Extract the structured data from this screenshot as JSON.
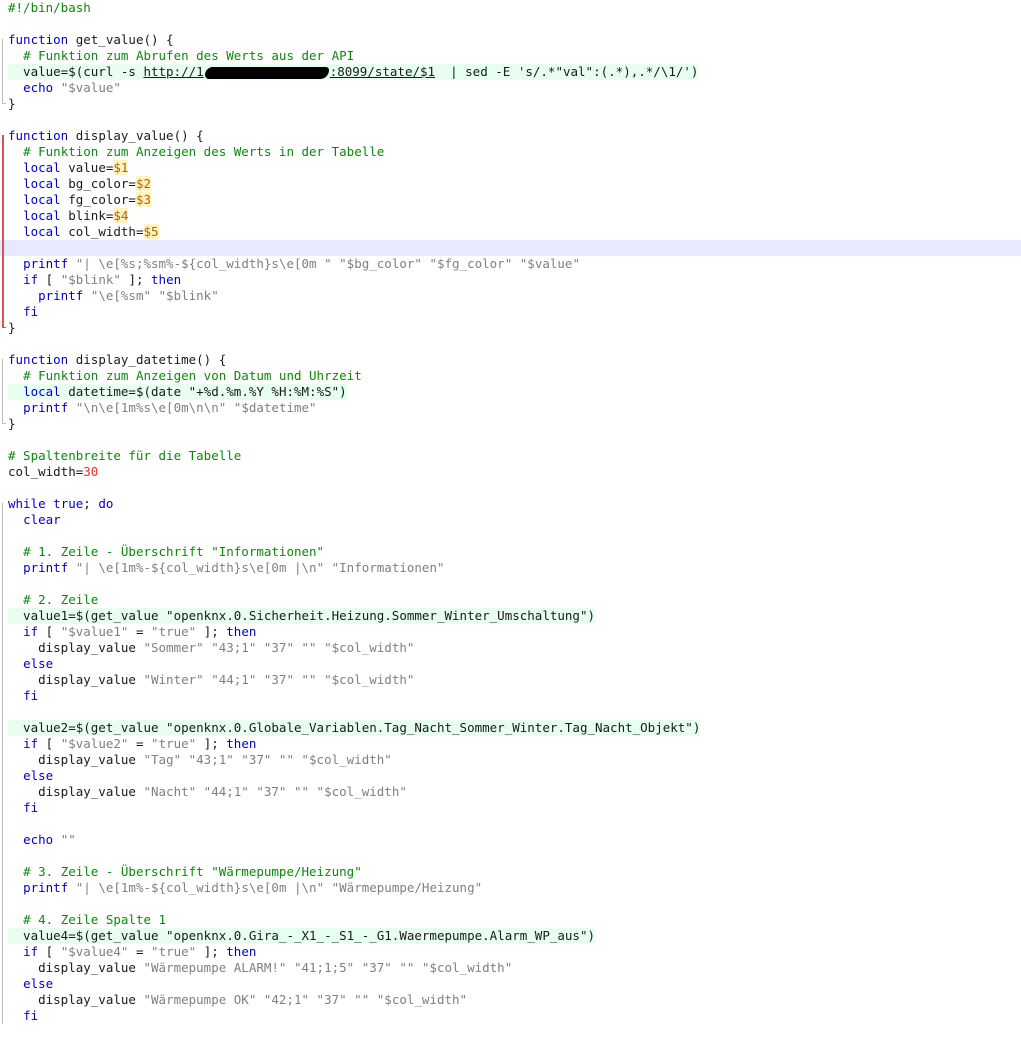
{
  "editor": {
    "language": "bash",
    "current_line": 16,
    "colors": {
      "comment": "#0a8a0a",
      "keyword": "#0000cc",
      "string": "#808080",
      "variable": "#c06000",
      "number": "#e03030",
      "current_line_bg": "#e8e8ff",
      "change_bar": "#e05050"
    },
    "lines": [
      {
        "fold": "none",
        "tokens": [
          [
            "comment",
            "#!/bin/bash"
          ]
        ]
      },
      {
        "fold": "none",
        "tokens": []
      },
      {
        "fold": "start",
        "tokens": [
          [
            "keyword",
            "function"
          ],
          [
            "plain",
            " get_value() {"
          ]
        ]
      },
      {
        "fold": "mid",
        "tokens": [
          [
            "plain",
            "  "
          ],
          [
            "comment",
            "# Funktion zum Abrufen des Werts aus der API"
          ]
        ]
      },
      {
        "fold": "mid",
        "hl": true,
        "tokens": [
          [
            "plain",
            "  value=$(curl -s "
          ],
          [
            "url",
            "http://1"
          ],
          [
            "redact",
            ""
          ],
          [
            "url",
            ":8099/state/$1"
          ],
          [
            "plain",
            "  | sed -E 's/.*\"val\":(.*),.*/\\1/')"
          ]
        ]
      },
      {
        "fold": "mid",
        "tokens": [
          [
            "plain",
            "  "
          ],
          [
            "keyword",
            "echo"
          ],
          [
            "plain",
            " "
          ],
          [
            "string",
            "\"$value\""
          ]
        ]
      },
      {
        "fold": "end",
        "tokens": [
          [
            "plain",
            "}"
          ]
        ]
      },
      {
        "fold": "none",
        "tokens": []
      },
      {
        "fold": "start-changed",
        "tokens": [
          [
            "keyword",
            "function"
          ],
          [
            "plain",
            " display_value() {"
          ]
        ]
      },
      {
        "fold": "mid-changed",
        "tokens": [
          [
            "plain",
            "  "
          ],
          [
            "comment",
            "# Funktion zum Anzeigen des Werts in der Tabelle"
          ]
        ]
      },
      {
        "fold": "mid-changed",
        "tokens": [
          [
            "plain",
            "  "
          ],
          [
            "keyword",
            "local"
          ],
          [
            "plain",
            " value="
          ],
          [
            "var",
            "$1"
          ]
        ]
      },
      {
        "fold": "mid-changed",
        "tokens": [
          [
            "plain",
            "  "
          ],
          [
            "keyword",
            "local"
          ],
          [
            "plain",
            " bg_color="
          ],
          [
            "var",
            "$2"
          ]
        ]
      },
      {
        "fold": "mid-changed",
        "tokens": [
          [
            "plain",
            "  "
          ],
          [
            "keyword",
            "local"
          ],
          [
            "plain",
            " fg_color="
          ],
          [
            "var",
            "$3"
          ]
        ]
      },
      {
        "fold": "mid-changed",
        "tokens": [
          [
            "plain",
            "  "
          ],
          [
            "keyword",
            "local"
          ],
          [
            "plain",
            " blink="
          ],
          [
            "var",
            "$4"
          ]
        ]
      },
      {
        "fold": "mid-changed",
        "tokens": [
          [
            "plain",
            "  "
          ],
          [
            "keyword",
            "local"
          ],
          [
            "plain",
            " col_width="
          ],
          [
            "var",
            "$5"
          ]
        ]
      },
      {
        "fold": "mid-changed",
        "current": true,
        "tokens": []
      },
      {
        "fold": "mid-changed",
        "tokens": [
          [
            "plain",
            "  "
          ],
          [
            "keyword",
            "printf"
          ],
          [
            "plain",
            " "
          ],
          [
            "string",
            "\"| \\e[%s;%sm%-${col_width}s\\e[0m \" \"$bg_color\" \"$fg_color\" \"$value\""
          ]
        ]
      },
      {
        "fold": "mid-changed",
        "tokens": [
          [
            "plain",
            "  "
          ],
          [
            "keyword",
            "if"
          ],
          [
            "plain",
            " [ "
          ],
          [
            "string",
            "\"$blink\""
          ],
          [
            "plain",
            " ]; "
          ],
          [
            "keyword",
            "then"
          ]
        ]
      },
      {
        "fold": "mid-changed",
        "tokens": [
          [
            "plain",
            "    "
          ],
          [
            "keyword",
            "printf"
          ],
          [
            "plain",
            " "
          ],
          [
            "string",
            "\"\\e[%sm\" \"$blink\""
          ]
        ]
      },
      {
        "fold": "mid-changed",
        "tokens": [
          [
            "plain",
            "  "
          ],
          [
            "keyword",
            "fi"
          ]
        ]
      },
      {
        "fold": "end-changed",
        "tokens": [
          [
            "plain",
            "}"
          ]
        ]
      },
      {
        "fold": "none",
        "tokens": []
      },
      {
        "fold": "start",
        "tokens": [
          [
            "keyword",
            "function"
          ],
          [
            "plain",
            " display_datetime() {"
          ]
        ]
      },
      {
        "fold": "mid",
        "tokens": [
          [
            "plain",
            "  "
          ],
          [
            "comment",
            "# Funktion zum Anzeigen von Datum und Uhrzeit"
          ]
        ]
      },
      {
        "fold": "mid",
        "hl": true,
        "tokens": [
          [
            "plain",
            "  "
          ],
          [
            "keyword",
            "local"
          ],
          [
            "plain",
            " datetime=$(date \"+%d.%m.%Y %H:%M:%S\")"
          ]
        ]
      },
      {
        "fold": "mid",
        "tokens": [
          [
            "plain",
            "  "
          ],
          [
            "keyword",
            "printf"
          ],
          [
            "plain",
            " "
          ],
          [
            "string",
            "\"\\n\\e[1m%s\\e[0m\\n\\n\" \"$datetime\""
          ]
        ]
      },
      {
        "fold": "end",
        "tokens": [
          [
            "plain",
            "}"
          ]
        ]
      },
      {
        "fold": "none",
        "tokens": []
      },
      {
        "fold": "none",
        "tokens": [
          [
            "comment",
            "# Spaltenbreite für die Tabelle"
          ]
        ]
      },
      {
        "fold": "none",
        "tokens": [
          [
            "plain",
            "col_width="
          ],
          [
            "num",
            "30"
          ]
        ]
      },
      {
        "fold": "none",
        "tokens": []
      },
      {
        "fold": "start",
        "tokens": [
          [
            "keyword",
            "while"
          ],
          [
            "plain",
            " "
          ],
          [
            "keyword",
            "true"
          ],
          [
            "plain",
            "; "
          ],
          [
            "keyword",
            "do"
          ]
        ]
      },
      {
        "fold": "mid",
        "tokens": [
          [
            "plain",
            "  "
          ],
          [
            "keyword",
            "clear"
          ]
        ]
      },
      {
        "fold": "mid",
        "tokens": []
      },
      {
        "fold": "mid",
        "tokens": [
          [
            "plain",
            "  "
          ],
          [
            "comment",
            "# 1. Zeile - Überschrift \"Informationen\""
          ]
        ]
      },
      {
        "fold": "mid",
        "tokens": [
          [
            "plain",
            "  "
          ],
          [
            "keyword",
            "printf"
          ],
          [
            "plain",
            " "
          ],
          [
            "string",
            "\"| \\e[1m%-${col_width}s\\e[0m |\\n\" \"Informationen\""
          ]
        ]
      },
      {
        "fold": "mid",
        "tokens": []
      },
      {
        "fold": "mid",
        "tokens": [
          [
            "plain",
            "  "
          ],
          [
            "comment",
            "# 2. Zeile"
          ]
        ]
      },
      {
        "fold": "mid",
        "hl": true,
        "tokens": [
          [
            "plain",
            "  value1=$(get_value \"openknx.0.Sicherheit.Heizung.Sommer_Winter_Umschaltung\")"
          ]
        ]
      },
      {
        "fold": "mid",
        "tokens": [
          [
            "plain",
            "  "
          ],
          [
            "keyword",
            "if"
          ],
          [
            "plain",
            " [ "
          ],
          [
            "string",
            "\"$value1\""
          ],
          [
            "plain",
            " = "
          ],
          [
            "string",
            "\"true\""
          ],
          [
            "plain",
            " ]; "
          ],
          [
            "keyword",
            "then"
          ]
        ]
      },
      {
        "fold": "mid",
        "tokens": [
          [
            "plain",
            "    display_value "
          ],
          [
            "string",
            "\"Sommer\" \"43;1\" \"37\" \"\" \"$col_width\""
          ]
        ]
      },
      {
        "fold": "mid",
        "tokens": [
          [
            "plain",
            "  "
          ],
          [
            "keyword",
            "else"
          ]
        ]
      },
      {
        "fold": "mid",
        "tokens": [
          [
            "plain",
            "    display_value "
          ],
          [
            "string",
            "\"Winter\" \"44;1\" \"37\" \"\" \"$col_width\""
          ]
        ]
      },
      {
        "fold": "mid",
        "tokens": [
          [
            "plain",
            "  "
          ],
          [
            "keyword",
            "fi"
          ]
        ]
      },
      {
        "fold": "mid",
        "tokens": []
      },
      {
        "fold": "mid",
        "hl": true,
        "tokens": [
          [
            "plain",
            "  value2=$(get_value \"openknx.0.Globale_Variablen.Tag_Nacht_Sommer_Winter.Tag_Nacht_Objekt\")"
          ]
        ]
      },
      {
        "fold": "mid",
        "tokens": [
          [
            "plain",
            "  "
          ],
          [
            "keyword",
            "if"
          ],
          [
            "plain",
            " [ "
          ],
          [
            "string",
            "\"$value2\""
          ],
          [
            "plain",
            " = "
          ],
          [
            "string",
            "\"true\""
          ],
          [
            "plain",
            " ]; "
          ],
          [
            "keyword",
            "then"
          ]
        ]
      },
      {
        "fold": "mid",
        "tokens": [
          [
            "plain",
            "    display_value "
          ],
          [
            "string",
            "\"Tag\" \"43;1\" \"37\" \"\" \"$col_width\""
          ]
        ]
      },
      {
        "fold": "mid",
        "tokens": [
          [
            "plain",
            "  "
          ],
          [
            "keyword",
            "else"
          ]
        ]
      },
      {
        "fold": "mid",
        "tokens": [
          [
            "plain",
            "    display_value "
          ],
          [
            "string",
            "\"Nacht\" \"44;1\" \"37\" \"\" \"$col_width\""
          ]
        ]
      },
      {
        "fold": "mid",
        "tokens": [
          [
            "plain",
            "  "
          ],
          [
            "keyword",
            "fi"
          ]
        ]
      },
      {
        "fold": "mid",
        "tokens": []
      },
      {
        "fold": "mid",
        "tokens": [
          [
            "plain",
            "  "
          ],
          [
            "keyword",
            "echo"
          ],
          [
            "plain",
            " "
          ],
          [
            "string",
            "\"\""
          ]
        ]
      },
      {
        "fold": "mid",
        "tokens": []
      },
      {
        "fold": "mid",
        "tokens": [
          [
            "plain",
            "  "
          ],
          [
            "comment",
            "# 3. Zeile - Überschrift \"Wärmepumpe/Heizung\""
          ]
        ]
      },
      {
        "fold": "mid",
        "tokens": [
          [
            "plain",
            "  "
          ],
          [
            "keyword",
            "printf"
          ],
          [
            "plain",
            " "
          ],
          [
            "string",
            "\"| \\e[1m%-${col_width}s\\e[0m |\\n\" \"Wärmepumpe/Heizung\""
          ]
        ]
      },
      {
        "fold": "mid",
        "tokens": []
      },
      {
        "fold": "mid",
        "tokens": [
          [
            "plain",
            "  "
          ],
          [
            "comment",
            "# 4. Zeile Spalte 1"
          ]
        ]
      },
      {
        "fold": "mid",
        "hl": true,
        "tokens": [
          [
            "plain",
            "  value4=$(get_value \"openknx.0.Gira_-_X1_-_S1_-_G1.Waermepumpe.Alarm_WP_aus\")"
          ]
        ]
      },
      {
        "fold": "mid",
        "tokens": [
          [
            "plain",
            "  "
          ],
          [
            "keyword",
            "if"
          ],
          [
            "plain",
            " [ "
          ],
          [
            "string",
            "\"$value4\""
          ],
          [
            "plain",
            " = "
          ],
          [
            "string",
            "\"true\""
          ],
          [
            "plain",
            " ]; "
          ],
          [
            "keyword",
            "then"
          ]
        ]
      },
      {
        "fold": "mid",
        "tokens": [
          [
            "plain",
            "    display_value "
          ],
          [
            "string",
            "\"Wärmepumpe ALARM!\" \"41;1;5\" \"37\" \"\" \"$col_width\""
          ]
        ]
      },
      {
        "fold": "mid",
        "tokens": [
          [
            "plain",
            "  "
          ],
          [
            "keyword",
            "else"
          ]
        ]
      },
      {
        "fold": "mid",
        "tokens": [
          [
            "plain",
            "    display_value "
          ],
          [
            "string",
            "\"Wärmepumpe OK\" \"42;1\" \"37\" \"\" \"$col_width\""
          ]
        ]
      },
      {
        "fold": "mid",
        "tokens": [
          [
            "plain",
            "  "
          ],
          [
            "keyword",
            "fi"
          ]
        ]
      }
    ]
  }
}
